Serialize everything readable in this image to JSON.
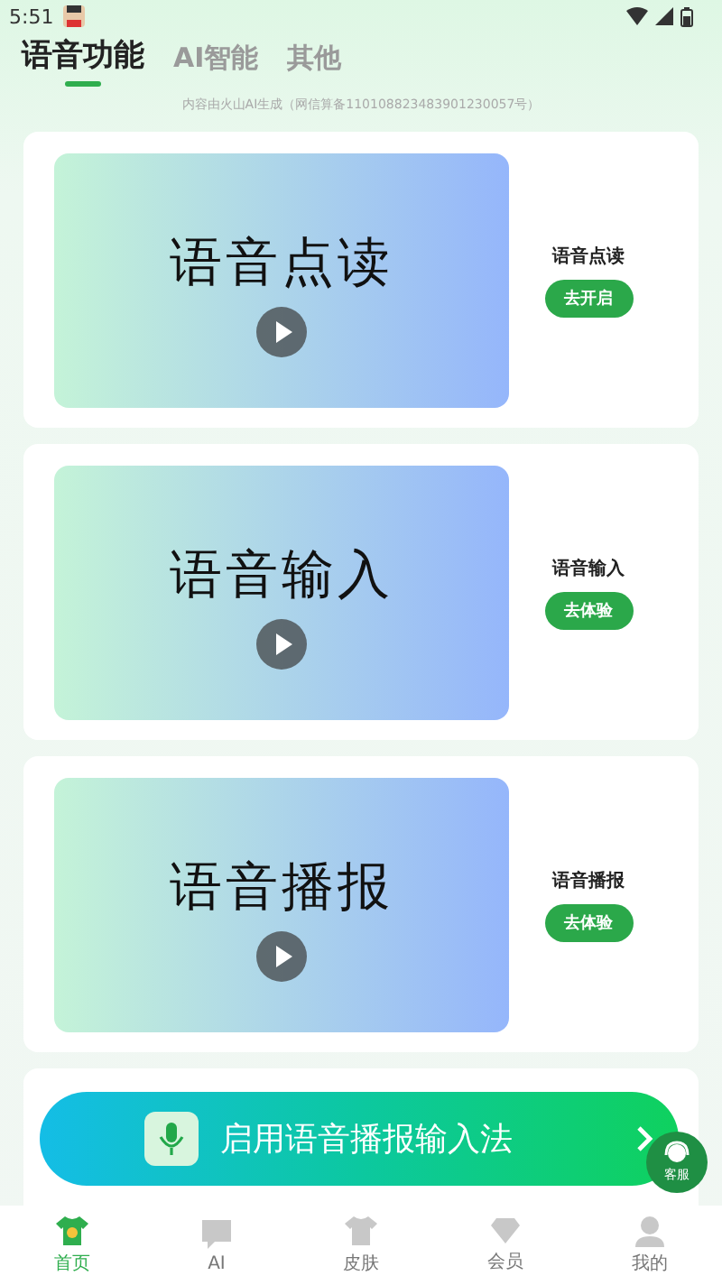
{
  "status_bar": {
    "time": "5:51"
  },
  "tabs": [
    {
      "label": "语音功能",
      "selected": true
    },
    {
      "label": "AI智能",
      "selected": false
    },
    {
      "label": "其他",
      "selected": false
    }
  ],
  "notice": "内容由火山AI生成（网信算备110108823483901230057号）",
  "cards": [
    {
      "thumbnail_text": "语音点读",
      "title": "语音点读",
      "button": "去开启"
    },
    {
      "thumbnail_text": "语音输入",
      "title": "语音输入",
      "button": "去体验"
    },
    {
      "thumbnail_text": "语音播报",
      "title": "语音播报",
      "button": "去体验"
    }
  ],
  "banner": {
    "label": "启用语音播报输入法"
  },
  "support": {
    "label": "客服"
  },
  "nav": [
    {
      "label": "首页",
      "selected": true
    },
    {
      "label": "AI",
      "selected": false
    },
    {
      "label": "皮肤",
      "selected": false
    },
    {
      "label": "会员",
      "selected": false
    },
    {
      "label": "我的",
      "selected": false
    }
  ]
}
